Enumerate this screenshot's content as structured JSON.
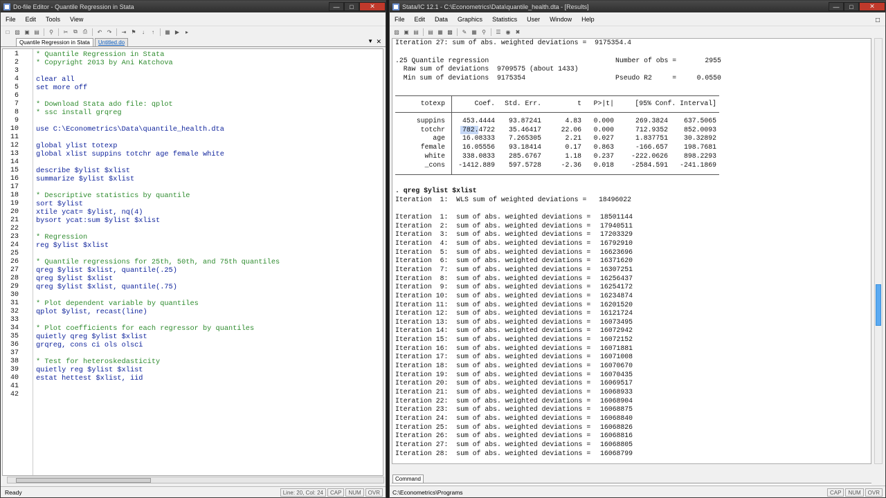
{
  "left_window": {
    "title": "Do-file Editor - Quantile Regression in Stata",
    "menu": [
      "File",
      "Edit",
      "Tools",
      "View"
    ],
    "tabs": {
      "active": "Quantile Regression in Stata",
      "inactive": "Untitled.do"
    },
    "lines": [
      {
        "n": "1",
        "t": "* Quantile Regression in Stata",
        "k": "comment"
      },
      {
        "n": "2",
        "t": "* Copyright 2013 by Ani Katchova",
        "k": "comment"
      },
      {
        "n": "3",
        "t": "",
        "k": "plain"
      },
      {
        "n": "4",
        "t": "clear all",
        "k": "kw"
      },
      {
        "n": "5",
        "t": "set more off",
        "k": "kw"
      },
      {
        "n": "6",
        "t": "",
        "k": "plain"
      },
      {
        "n": "7",
        "t": "* Download Stata ado file: qplot",
        "k": "comment"
      },
      {
        "n": "8",
        "t": "* ssc install grqreg",
        "k": "comment"
      },
      {
        "n": "9",
        "t": "",
        "k": "plain"
      },
      {
        "n": "10",
        "t": "use C:\\Econometrics\\Data\\quantile_health.dta",
        "k": "kw"
      },
      {
        "n": "11",
        "t": "",
        "k": "plain"
      },
      {
        "n": "12",
        "t": "global ylist totexp",
        "k": "kw"
      },
      {
        "n": "13",
        "t": "global xlist suppins totchr age female white",
        "k": "kw"
      },
      {
        "n": "14",
        "t": "",
        "k": "plain"
      },
      {
        "n": "15",
        "t": "describe $ylist $xlist",
        "k": "kw"
      },
      {
        "n": "16",
        "t": "summarize $ylist $xlist",
        "k": "kw"
      },
      {
        "n": "17",
        "t": "",
        "k": "plain"
      },
      {
        "n": "18",
        "t": "* Descriptive statistics by quantile",
        "k": "comment"
      },
      {
        "n": "19",
        "t": "sort $ylist",
        "k": "kw"
      },
      {
        "n": "20",
        "t": "xtile ycat= $ylist, nq(4)",
        "k": "kw"
      },
      {
        "n": "21",
        "t": "bysort ycat:sum $ylist $xlist",
        "k": "kw"
      },
      {
        "n": "22",
        "t": "",
        "k": "plain"
      },
      {
        "n": "23",
        "t": "* Regression",
        "k": "comment"
      },
      {
        "n": "24",
        "t": "reg $ylist $xlist",
        "k": "kw"
      },
      {
        "n": "25",
        "t": "",
        "k": "plain"
      },
      {
        "n": "26",
        "t": "* Quantile regressions for 25th, 50th, and 75th quantiles",
        "k": "comment"
      },
      {
        "n": "27",
        "t": "qreg $ylist $xlist, quantile(.25)",
        "k": "kw"
      },
      {
        "n": "28",
        "t": "qreg $ylist $xlist",
        "k": "kw"
      },
      {
        "n": "29",
        "t": "qreg $ylist $xlist, quantile(.75)",
        "k": "kw"
      },
      {
        "n": "30",
        "t": "",
        "k": "plain"
      },
      {
        "n": "31",
        "t": "* Plot dependent variable by quantiles",
        "k": "comment"
      },
      {
        "n": "32",
        "t": "qplot $ylist, recast(line)",
        "k": "kw"
      },
      {
        "n": "33",
        "t": "",
        "k": "plain"
      },
      {
        "n": "34",
        "t": "* Plot coefficients for each regressor by quantiles",
        "k": "comment"
      },
      {
        "n": "35",
        "t": "quietly qreg $ylist $xlist",
        "k": "kw"
      },
      {
        "n": "36",
        "t": "grqreg, cons ci ols olsci",
        "k": "kw"
      },
      {
        "n": "37",
        "t": "",
        "k": "plain"
      },
      {
        "n": "38",
        "t": "* Test for heteroskedasticity",
        "k": "comment"
      },
      {
        "n": "39",
        "t": "quietly reg $ylist $xlist",
        "k": "kw"
      },
      {
        "n": "40",
        "t": "estat hettest $xlist, iid",
        "k": "kw"
      },
      {
        "n": "41",
        "t": "",
        "k": "plain"
      },
      {
        "n": "42",
        "t": "",
        "k": "plain"
      }
    ],
    "status": {
      "text": "Ready",
      "position": "Line: 20, Col: 24",
      "caps": "CAP",
      "num": "NUM",
      "ovr": "OVR"
    }
  },
  "right_window": {
    "title": "Stata/IC 12.1 - C:\\Econometrics\\Data\\quantile_health.dta - [Results]",
    "menu": [
      "File",
      "Edit",
      "Data",
      "Graphics",
      "Statistics",
      "User",
      "Window",
      "Help"
    ],
    "top_line": "Iteration 27: sum of abs. weighted deviations =  9175354.4",
    "header": {
      "l1": ".25 Quantile regression",
      "l1r": "Number of obs =       2955",
      "l2": "  Raw sum of deviations  9709575 (about 1433)",
      "l3": "  Min sum of deviations  9175354",
      "l3r": "Pseudo R2     =     0.0550"
    },
    "table": {
      "headers": [
        "totexp",
        "Coef.",
        "Std. Err.",
        "t",
        "P>|t|",
        "[95% Conf. Interval]"
      ],
      "rows": [
        [
          "suppins",
          "453.4444",
          "93.87241",
          "4.83",
          "0.000",
          "269.3824",
          "637.5065"
        ],
        [
          "totchr",
          "782.4722",
          "35.46417",
          "22.06",
          "0.000",
          "712.9352",
          "852.0093"
        ],
        [
          "age",
          "16.08333",
          "7.265305",
          "2.21",
          "0.027",
          "1.837751",
          "30.32892"
        ],
        [
          "female",
          "16.05556",
          "93.18414",
          "0.17",
          "0.863",
          "-166.657",
          "198.7681"
        ],
        [
          "white",
          "338.0833",
          "285.6767",
          "1.18",
          "0.237",
          "-222.0626",
          "898.2293"
        ],
        [
          "_cons",
          "-1412.889",
          "597.5728",
          "-2.36",
          "0.018",
          "-2584.591",
          "-241.1869"
        ]
      ]
    },
    "command_echo": ". qreg $ylist $xlist",
    "wls_line": "Iteration  1:  WLS sum of weighted deviations =   18496022",
    "iterations": [
      [
        "1",
        "18501144"
      ],
      [
        "2",
        "17940511"
      ],
      [
        "3",
        "17203329"
      ],
      [
        "4",
        "16792910"
      ],
      [
        "5",
        "16623696"
      ],
      [
        "6",
        "16371620"
      ],
      [
        "7",
        "16307251"
      ],
      [
        "8",
        "16256437"
      ],
      [
        "9",
        "16254172"
      ],
      [
        "10",
        "16234874"
      ],
      [
        "11",
        "16201520"
      ],
      [
        "12",
        "16121724"
      ],
      [
        "13",
        "16073495"
      ],
      [
        "14",
        "16072942"
      ],
      [
        "15",
        "16072152"
      ],
      [
        "16",
        "16071881"
      ],
      [
        "17",
        "16071008"
      ],
      [
        "18",
        "16070670"
      ],
      [
        "19",
        "16070435"
      ],
      [
        "20",
        "16069517"
      ],
      [
        "21",
        "16068933"
      ],
      [
        "22",
        "16068904"
      ],
      [
        "23",
        "16068875"
      ],
      [
        "24",
        "16068840"
      ],
      [
        "25",
        "16068826"
      ],
      [
        "26",
        "16068816"
      ],
      [
        "27",
        "16068805"
      ],
      [
        "28",
        "16068799"
      ]
    ],
    "command_tab": "Command",
    "status": {
      "path": "C:\\Econometrics\\Programs",
      "caps": "CAP",
      "num": "NUM",
      "ovr": "OVR"
    }
  },
  "colors": {
    "comment": "#2e8b2e",
    "keyword": "#0a1f9a",
    "scroll_thumb": "#5aaaf2"
  }
}
